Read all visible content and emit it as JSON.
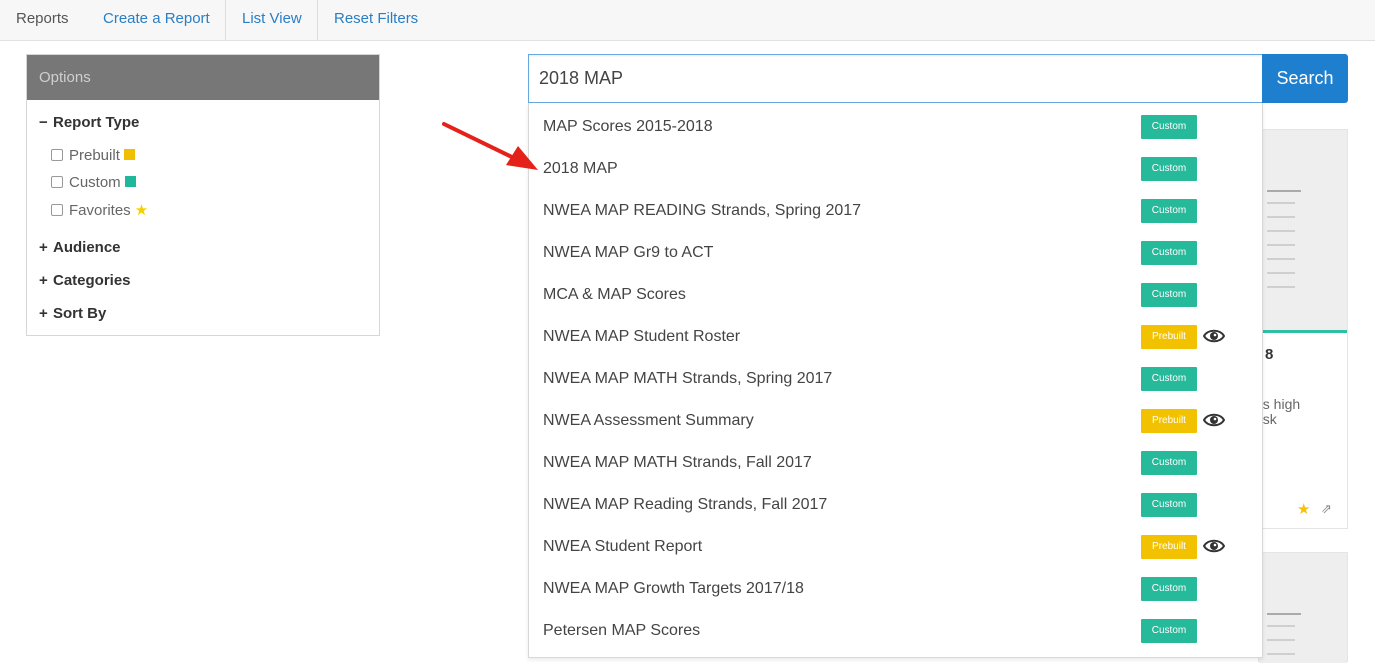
{
  "nav": {
    "brand": "Reports",
    "links": [
      "Create a Report",
      "List View",
      "Reset Filters"
    ]
  },
  "options": {
    "header": "Options",
    "report_type": {
      "title": "Report Type",
      "items": [
        {
          "label": "Prebuilt",
          "marker": "square",
          "color": "#f0c000"
        },
        {
          "label": "Custom",
          "marker": "square",
          "color": "#1fb89a"
        },
        {
          "label": "Favorites",
          "marker": "star",
          "color": "#f5d000"
        }
      ]
    },
    "sections": [
      "Audience",
      "Categories",
      "Sort By"
    ]
  },
  "search": {
    "value": "2018 MAP",
    "button": "Search"
  },
  "background_card": {
    "title_fragment": "8",
    "text_line1": "es high",
    "text_line2": "risk"
  },
  "colors": {
    "custom": "#26b99a",
    "prebuilt": "#f2c200",
    "search_button": "#1f7fcf",
    "link": "#2a7ec4"
  },
  "suggestions": [
    {
      "label": "MAP Scores 2015-2018",
      "badge": "Custom",
      "eye": false
    },
    {
      "label": "2018 MAP",
      "badge": "Custom",
      "eye": false
    },
    {
      "label": "NWEA MAP READING Strands, Spring 2017",
      "badge": "Custom",
      "eye": false
    },
    {
      "label": "NWEA MAP Gr9 to ACT",
      "badge": "Custom",
      "eye": false
    },
    {
      "label": "MCA & MAP Scores",
      "badge": "Custom",
      "eye": false
    },
    {
      "label": "NWEA MAP Student Roster",
      "badge": "Prebuilt",
      "eye": true
    },
    {
      "label": "NWEA MAP MATH Strands, Spring 2017",
      "badge": "Custom",
      "eye": false
    },
    {
      "label": "NWEA Assessment Summary",
      "badge": "Prebuilt",
      "eye": true
    },
    {
      "label": "NWEA MAP MATH Strands, Fall 2017",
      "badge": "Custom",
      "eye": false
    },
    {
      "label": "NWEA MAP Reading Strands, Fall 2017",
      "badge": "Custom",
      "eye": false
    },
    {
      "label": "NWEA Student Report",
      "badge": "Prebuilt",
      "eye": true
    },
    {
      "label": "NWEA MAP Growth Targets 2017/18",
      "badge": "Custom",
      "eye": false
    },
    {
      "label": "Petersen MAP Scores",
      "badge": "Custom",
      "eye": false
    }
  ]
}
